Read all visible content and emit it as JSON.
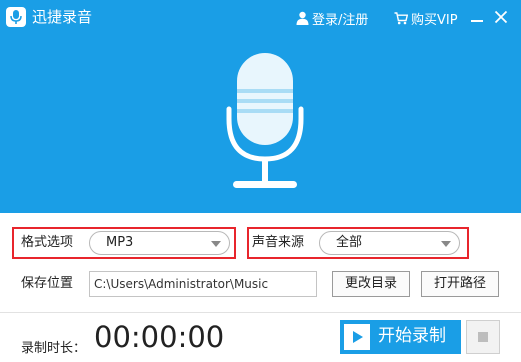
{
  "app": {
    "title": "迅捷录音",
    "login_label": "登录/注册",
    "vip_label": "购买VIP"
  },
  "colors": {
    "brand_blue": "#1a9ee6",
    "highlight_red": "#e8252c"
  },
  "icons": {
    "logo": "microphone-icon",
    "user": "user-icon",
    "cart": "cart-icon",
    "minimize": "minimize-icon",
    "close": "close-icon",
    "play": "play-icon",
    "stop": "stop-icon"
  },
  "settings": {
    "format_label": "格式选项",
    "format_value": "MP3",
    "source_label": "声音来源",
    "source_value": "全部",
    "save_label": "保存位置",
    "save_path": "C:\\Users\\Administrator\\Music",
    "change_dir_label": "更改目录",
    "open_path_label": "打开路径"
  },
  "recording": {
    "duration_label": "录制时长：",
    "timer": "00:00:00",
    "start_label": "开始录制"
  }
}
